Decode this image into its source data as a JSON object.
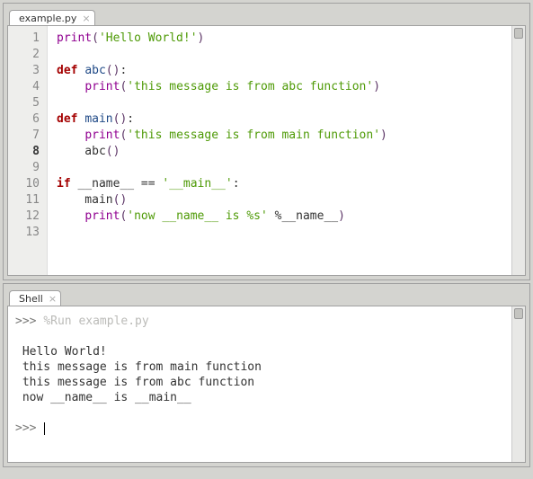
{
  "editor": {
    "tab_label": "example.py",
    "current_line": 8,
    "lines": [
      {
        "n": "1",
        "tokens": [
          {
            "t": "print",
            "c": "builtin"
          },
          {
            "t": "(",
            "c": "paren"
          },
          {
            "t": "'Hello World!'",
            "c": "str"
          },
          {
            "t": ")",
            "c": "paren"
          }
        ]
      },
      {
        "n": "2",
        "tokens": []
      },
      {
        "n": "3",
        "tokens": [
          {
            "t": "def ",
            "c": "kw"
          },
          {
            "t": "abc",
            "c": "fn"
          },
          {
            "t": "()",
            "c": "paren"
          },
          {
            "t": ":",
            "c": ""
          }
        ]
      },
      {
        "n": "4",
        "tokens": [
          {
            "t": "    ",
            "c": ""
          },
          {
            "t": "print",
            "c": "builtin"
          },
          {
            "t": "(",
            "c": "paren"
          },
          {
            "t": "'this message is from abc function'",
            "c": "str"
          },
          {
            "t": ")",
            "c": "paren"
          }
        ]
      },
      {
        "n": "5",
        "tokens": []
      },
      {
        "n": "6",
        "tokens": [
          {
            "t": "def ",
            "c": "kw"
          },
          {
            "t": "main",
            "c": "fn"
          },
          {
            "t": "()",
            "c": "paren"
          },
          {
            "t": ":",
            "c": ""
          }
        ]
      },
      {
        "n": "7",
        "tokens": [
          {
            "t": "    ",
            "c": ""
          },
          {
            "t": "print",
            "c": "builtin"
          },
          {
            "t": "(",
            "c": "paren"
          },
          {
            "t": "'this message is from main function'",
            "c": "str"
          },
          {
            "t": ")",
            "c": "paren"
          }
        ]
      },
      {
        "n": "8",
        "tokens": [
          {
            "t": "    abc",
            "c": ""
          },
          {
            "t": "()",
            "c": "paren"
          }
        ]
      },
      {
        "n": "9",
        "tokens": []
      },
      {
        "n": "10",
        "tokens": [
          {
            "t": "if ",
            "c": "kw"
          },
          {
            "t": "__name__ == ",
            "c": ""
          },
          {
            "t": "'__main__'",
            "c": "str"
          },
          {
            "t": ":",
            "c": ""
          }
        ]
      },
      {
        "n": "11",
        "tokens": [
          {
            "t": "    main",
            "c": ""
          },
          {
            "t": "()",
            "c": "paren"
          }
        ]
      },
      {
        "n": "12",
        "tokens": [
          {
            "t": "    ",
            "c": ""
          },
          {
            "t": "print",
            "c": "builtin"
          },
          {
            "t": "(",
            "c": "paren"
          },
          {
            "t": "'now __name__ is %s'",
            "c": "str"
          },
          {
            "t": " %__name__",
            "c": ""
          },
          {
            "t": ")",
            "c": "paren"
          }
        ]
      },
      {
        "n": "13",
        "tokens": []
      }
    ]
  },
  "shell": {
    "tab_label": "Shell",
    "prompt": ">>>",
    "run_command": "%Run example.py",
    "output": [
      "Hello World!",
      "this message is from main function",
      "this message is from abc function",
      "now __name__ is __main__"
    ]
  }
}
